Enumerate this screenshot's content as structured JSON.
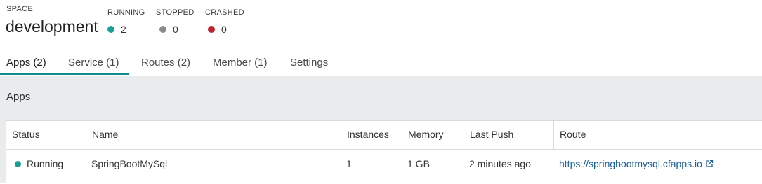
{
  "space": {
    "label": "SPACE",
    "name": "development"
  },
  "stats": [
    {
      "label": "RUNNING",
      "value": "2",
      "color": "#1a9e96"
    },
    {
      "label": "STOPPED",
      "value": "0",
      "color": "#8a8a8a"
    },
    {
      "label": "CRASHED",
      "value": "0",
      "color": "#c0232d"
    }
  ],
  "tabs": [
    {
      "label": "Apps (2)",
      "active": true
    },
    {
      "label": "Service (1)"
    },
    {
      "label": "Routes (2)"
    },
    {
      "label": "Member (1)"
    },
    {
      "label": "Settings"
    }
  ],
  "panel": {
    "title": "Apps"
  },
  "table": {
    "headers": [
      "Status",
      "Name",
      "Instances",
      "Memory",
      "Last Push",
      "Route"
    ],
    "rows": [
      {
        "status": "Running",
        "status_color": "#1a9e96",
        "name": "SpringBootMySql",
        "instances": "1",
        "memory": "1 GB",
        "last_push": "2 minutes ago",
        "route": "https://springbootmysql.cfapps.io"
      }
    ]
  }
}
